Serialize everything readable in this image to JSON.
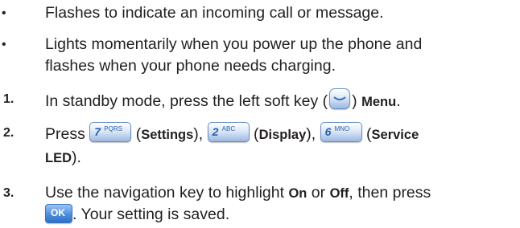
{
  "bullets": [
    {
      "marker": "•",
      "text": "Flashes to indicate an incoming call or message."
    },
    {
      "marker": "•",
      "line1": "Lights momentarily when you power up the phone and",
      "line2": "flashes when your phone needs charging."
    }
  ],
  "steps": [
    {
      "number": "1.",
      "pre": "In standby mode, press the left soft key (",
      "post": ") ",
      "menu": "Menu",
      "end": "."
    },
    {
      "number": "2.",
      "press": "Press",
      "key1": {
        "digit": "7",
        "letters": "PQRS"
      },
      "settings": "Settings",
      "key2": {
        "digit": "2",
        "letters": "ABC"
      },
      "display": "Display",
      "key3": {
        "digit": "6",
        "letters": "MNO"
      },
      "service": "Service",
      "led": "LED",
      "led_end": ")."
    },
    {
      "number": "3.",
      "pre": "Use the navigation key to highlight ",
      "on": "On",
      "or": " or ",
      "off": "Off",
      "post": ", then press",
      "ok_label": "OK",
      "saved": ". Your setting is saved."
    }
  ]
}
